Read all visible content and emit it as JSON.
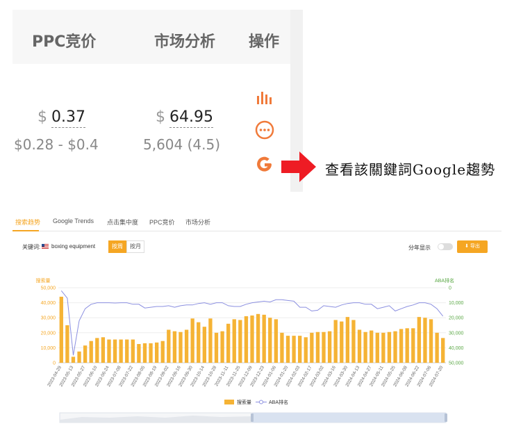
{
  "table": {
    "headers": [
      "PPC竞价",
      "市场分析",
      "操作"
    ],
    "ppc": {
      "currency": "$",
      "value": "0.37",
      "range": "$0.28 - $0.4"
    },
    "market": {
      "currency": "$",
      "value": "64.95",
      "sub": "5,604 (4.5)"
    }
  },
  "annotation": {
    "note": "查看該關鍵詞Google趨勢"
  },
  "tabs": [
    "搜索趋势",
    "Google Trends",
    "点击集中度",
    "PPC竞价",
    "市场分析"
  ],
  "controls": {
    "keyword_label": "关键词:",
    "keyword_value": "boxing equipment",
    "period_buttons": [
      "按周",
      "按月"
    ],
    "split_year_label": "分年显示",
    "export_label": "导出"
  },
  "colors": {
    "accent": "#f5a623",
    "bar": "#f5b335",
    "line": "#8b8fe0",
    "rank_axis": "#5aa845"
  },
  "chart_data": {
    "type": "bar",
    "left_axis_title": "搜索量",
    "right_axis_title": "ABA排名",
    "legend": [
      "搜索量",
      "ABA排名"
    ],
    "left_ylim": [
      0,
      50000
    ],
    "left_ticks": [
      "0",
      "10,000",
      "20,000",
      "30,000",
      "40,000",
      "50,000"
    ],
    "right_ylim": [
      0,
      50000
    ],
    "right_ticks": [
      "0",
      "10,000",
      "20,000",
      "30,000",
      "40,000",
      "50,000"
    ],
    "right_inverted": true,
    "x_labels": [
      "2023-04-29",
      "2023-05-13",
      "2023-05-27",
      "2023-06-10",
      "2023-06-24",
      "2023-07-08",
      "2023-07-22",
      "2023-08-05",
      "2023-08-19",
      "2023-09-02",
      "2023-09-16",
      "2023-09-30",
      "2023-10-14",
      "2023-10-28",
      "2023-11-11",
      "2023-11-25",
      "2023-12-09",
      "2023-12-23",
      "2024-01-06",
      "2024-01-20",
      "2024-02-03",
      "2024-02-17",
      "2024-03-02",
      "2024-03-16",
      "2024-03-30",
      "2024-04-13",
      "2024-04-27",
      "2024-05-11",
      "2024-05-25",
      "2024-06-08",
      "2024-06-22",
      "2024-07-06",
      "2024-07-20"
    ],
    "volume": [
      44000,
      25000,
      4000,
      7500,
      11500,
      14500,
      16500,
      17000,
      15500,
      15500,
      15500,
      15500,
      15500,
      12500,
      13000,
      13000,
      13500,
      14500,
      22000,
      21000,
      20500,
      22000,
      29500,
      27000,
      24000,
      29500,
      20000,
      21000,
      26000,
      29000,
      28500,
      31000,
      31500,
      32500,
      32000,
      30000,
      29000,
      20000,
      18000,
      18000,
      18000,
      17000,
      20000,
      20500,
      20500,
      21000,
      28500,
      27500,
      30500,
      28500,
      22000,
      20500,
      21500,
      20000,
      20000,
      20500,
      21000,
      22500,
      23000,
      23000,
      30500,
      30000,
      29000,
      20000,
      16500
    ],
    "rank": [
      2000,
      7000,
      45000,
      22000,
      14000,
      11000,
      10000,
      10000,
      10000,
      10200,
      10000,
      10000,
      11000,
      11000,
      13500,
      13000,
      12500,
      12500,
      12000,
      13000,
      12000,
      11500,
      11500,
      10500,
      10000,
      11000,
      10000,
      10000,
      12000,
      12500,
      12500,
      11000,
      10000,
      9500,
      9000,
      9500,
      8000,
      8000,
      8500,
      9000,
      13000,
      13000,
      15500,
      15000,
      12000,
      12500,
      13000,
      11500,
      10500,
      10000,
      10000,
      11000,
      11000,
      14000,
      13000,
      12000,
      15500,
      14000,
      12500,
      11500,
      10000,
      10000,
      11000,
      14000,
      19000
    ]
  }
}
